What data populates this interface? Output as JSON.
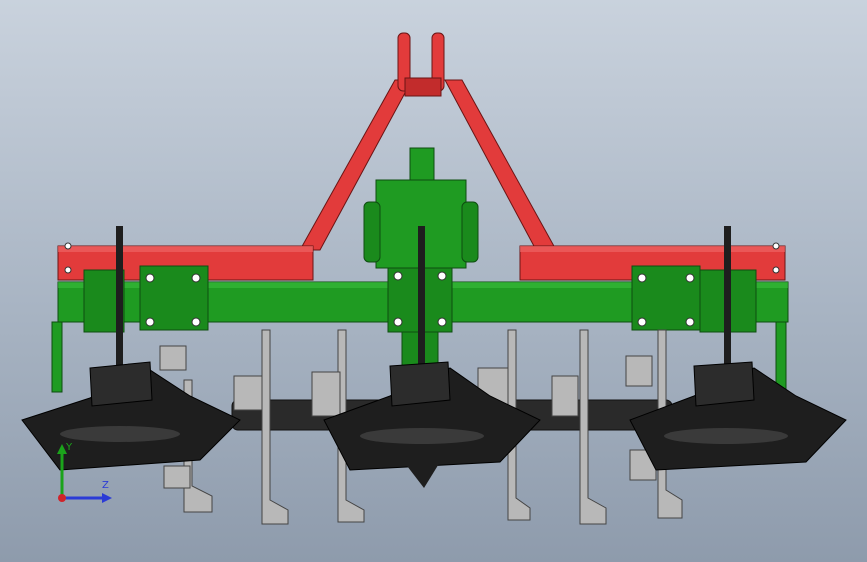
{
  "viewport": {
    "background_top": "#c9d2dd",
    "background_bottom": "#8e9bac"
  },
  "colors": {
    "frame_red": "#e23b3b",
    "frame_red_dark": "#b02424",
    "frame_green": "#1f9b22",
    "frame_green_dark": "#146b16",
    "blade_black": "#1e1e1e",
    "tine_steel": "#b8b8b8",
    "axis_x": "#d0232a",
    "axis_y": "#1ba31b",
    "axis_z": "#2b3bd6"
  },
  "triad": {
    "y_label": "Y",
    "z_label": "Z",
    "x_icon": "x-axis-dot-icon"
  }
}
